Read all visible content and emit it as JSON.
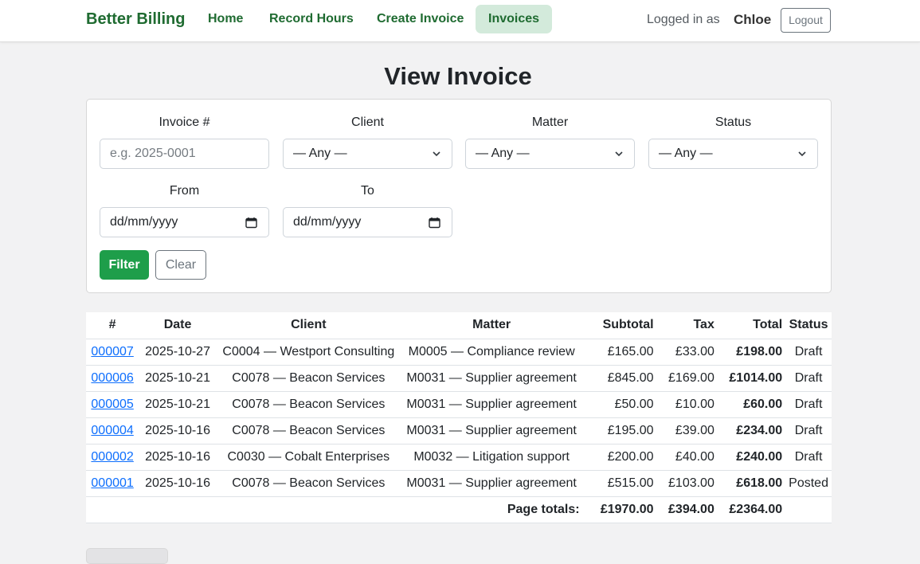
{
  "nav": {
    "brand": "Better Billing",
    "links": [
      "Home",
      "Record Hours",
      "Create Invoice",
      "Invoices"
    ],
    "active": "Invoices",
    "logged_in_label": "Logged in as",
    "user": "Chloe",
    "logout_label": "Logout"
  },
  "page": {
    "title": "View Invoice"
  },
  "filters": {
    "invoice_label": "Invoice #",
    "invoice_placeholder": "e.g. 2025-0001",
    "client_label": "Client",
    "client_value": "— Any —",
    "matter_label": "Matter",
    "matter_value": "— Any —",
    "status_label": "Status",
    "status_value": "— Any —",
    "from_label": "From",
    "from_value": "dd/mm/yyyy",
    "to_label": "To",
    "to_value": "dd/mm/yyyy",
    "filter_button": "Filter",
    "clear_button": "Clear"
  },
  "table": {
    "headers": [
      "#",
      "Date",
      "Client",
      "Matter",
      "Subtotal",
      "Tax",
      "Total",
      "Status"
    ],
    "rows": [
      {
        "num": "000007",
        "date": "2025-10-27",
        "client": "C0004 — Westport Consulting",
        "matter": "M0005 — Compliance review",
        "subtotal": "£165.00",
        "tax": "£33.00",
        "total": "£198.00",
        "status": "Draft"
      },
      {
        "num": "000006",
        "date": "2025-10-21",
        "client": "C0078 — Beacon Services",
        "matter": "M0031 — Supplier agreement",
        "subtotal": "£845.00",
        "tax": "£169.00",
        "total": "£1014.00",
        "status": "Draft"
      },
      {
        "num": "000005",
        "date": "2025-10-21",
        "client": "C0078 — Beacon Services",
        "matter": "M0031 — Supplier agreement",
        "subtotal": "£50.00",
        "tax": "£10.00",
        "total": "£60.00",
        "status": "Draft"
      },
      {
        "num": "000004",
        "date": "2025-10-16",
        "client": "C0078 — Beacon Services",
        "matter": "M0031 — Supplier agreement",
        "subtotal": "£195.00",
        "tax": "£39.00",
        "total": "£234.00",
        "status": "Draft"
      },
      {
        "num": "000002",
        "date": "2025-10-16",
        "client": "C0030 — Cobalt Enterprises",
        "matter": "M0032 — Litigation support",
        "subtotal": "£200.00",
        "tax": "£40.00",
        "total": "£240.00",
        "status": "Draft"
      },
      {
        "num": "000001",
        "date": "2025-10-16",
        "client": "C0078 — Beacon Services",
        "matter": "M0031 — Supplier agreement",
        "subtotal": "£515.00",
        "tax": "£103.00",
        "total": "£618.00",
        "status": "Posted"
      }
    ],
    "totals": {
      "label": "Page totals:",
      "subtotal": "£1970.00",
      "tax": "£394.00",
      "total": "£2364.00"
    }
  },
  "colors": {
    "brand": "#1f6b31",
    "active_tab_bg": "#d3eadb",
    "filter_button": "#1e9e4a",
    "link": "#0d6efd"
  }
}
